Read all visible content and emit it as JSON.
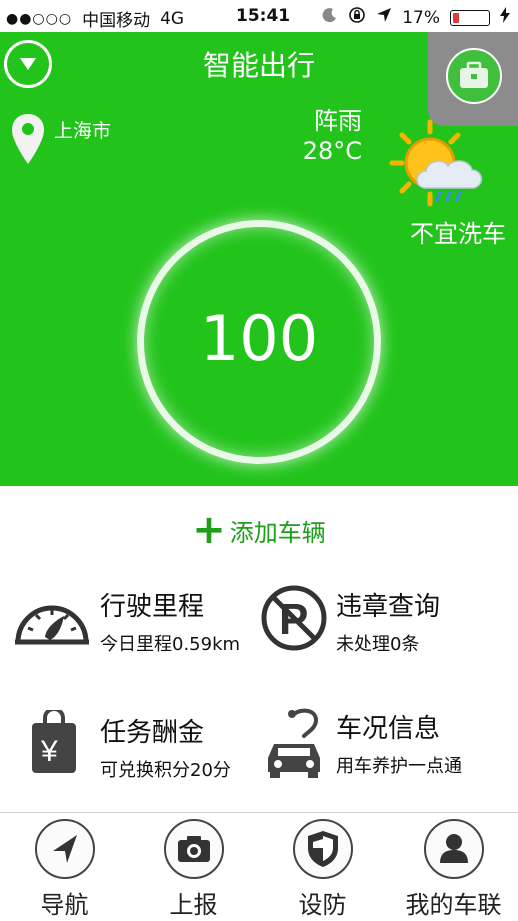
{
  "status_bar": {
    "signal": "●●○○○",
    "carrier": "中国移动",
    "network": "4G",
    "time": "15:41",
    "battery_percent": "17%",
    "battery_level": 0.17
  },
  "hero": {
    "title": "智能出行",
    "location": "上海市",
    "weather": {
      "condition": "阵雨",
      "temperature": "28°C"
    },
    "car_wash": "不宜洗车",
    "score": "100",
    "background_color": "#22c41b"
  },
  "add_vehicle": {
    "plus": "+",
    "label": "添加车辆"
  },
  "features": [
    {
      "title": "行驶里程",
      "subtitle": "今日里程0.59km",
      "icon": "speedometer-icon"
    },
    {
      "title": "违章查询",
      "subtitle": "未处理0条",
      "icon": "no-parking-icon"
    },
    {
      "title": "任务酬金",
      "subtitle": "可兑换积分20分",
      "icon": "shopping-bag-yen-icon"
    },
    {
      "title": "车况信息",
      "subtitle": "用车养护一点通",
      "icon": "car-stethoscope-icon"
    }
  ],
  "tabs": [
    {
      "label": "导航",
      "icon": "navigation-arrow-icon"
    },
    {
      "label": "上报",
      "icon": "camera-icon"
    },
    {
      "label": "设防",
      "icon": "shield-icon"
    },
    {
      "label": "我的车联",
      "icon": "user-icon"
    }
  ]
}
